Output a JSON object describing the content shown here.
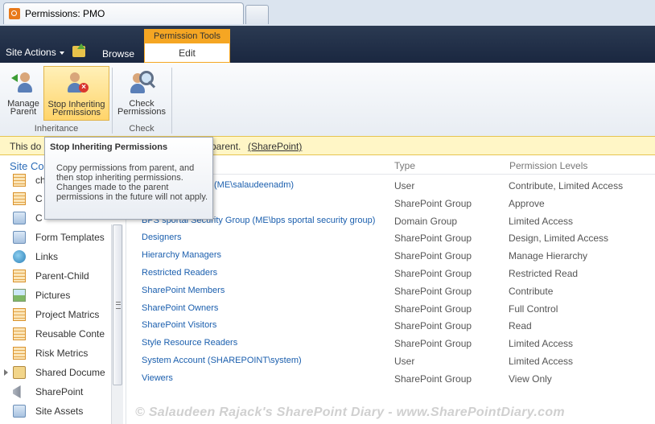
{
  "browser": {
    "tab_title": "Permissions: PMO"
  },
  "ribbon": {
    "site_actions": "Site Actions",
    "browse_tab": "Browse",
    "contextual_group": "Permission Tools",
    "edit_tab": "Edit",
    "buttons": {
      "manage_parent_l1": "Manage",
      "manage_parent_l2": "Parent",
      "stop_inheriting_l1": "Stop Inheriting",
      "stop_inheriting_l2": "Permissions",
      "check_permissions_l1": "Check",
      "check_permissions_l2": "Permissions"
    },
    "groups": {
      "inheritance": "Inheritance",
      "check": "Check"
    }
  },
  "notification": {
    "text_start": "This do",
    "text_end": "parent.",
    "link": "(SharePoint)"
  },
  "tooltip": {
    "title": "Stop Inheriting Permissions",
    "body": "Copy permissions from parent, and then stop inheriting permissions. Changes made to the parent permissions in the future will not apply."
  },
  "leftnav": {
    "header": "Site Co",
    "items": [
      {
        "label": "ch",
        "icon": "list-icon"
      },
      {
        "label": "C",
        "icon": "list-icon"
      },
      {
        "label": "C",
        "icon": "library-icon"
      },
      {
        "label": "Form Templates",
        "icon": "library-icon"
      },
      {
        "label": "Links",
        "icon": "links-icon"
      },
      {
        "label": "Parent-Child",
        "icon": "list-icon"
      },
      {
        "label": "Pictures",
        "icon": "picture-library-icon"
      },
      {
        "label": "Project Matrics",
        "icon": "list-icon"
      },
      {
        "label": "Reusable Conte",
        "icon": "list-icon"
      },
      {
        "label": "Risk Metrics",
        "icon": "list-icon"
      },
      {
        "label": "Shared Docume",
        "icon": "document-library-icon"
      },
      {
        "label": "SharePoint",
        "icon": "announcements-icon"
      },
      {
        "label": "Site Assets",
        "icon": "library-icon"
      }
    ]
  },
  "table": {
    "headers": {
      "type": "Type",
      "levels": "Permission Levels"
    },
    "rows": [
      {
        "name": "(ME\\salaudeenadm)",
        "type": "User",
        "levels": "Contribute, Limited Access"
      },
      {
        "name": "",
        "type": "SharePoint Group",
        "levels": "Approve"
      },
      {
        "name": "BPS sportal Security Group (ME\\bps sportal security group)",
        "type": "Domain Group",
        "levels": "Limited Access"
      },
      {
        "name": "Designers",
        "type": "SharePoint Group",
        "levels": "Design, Limited Access"
      },
      {
        "name": "Hierarchy Managers",
        "type": "SharePoint Group",
        "levels": "Manage Hierarchy"
      },
      {
        "name": "Restricted Readers",
        "type": "SharePoint Group",
        "levels": "Restricted Read"
      },
      {
        "name": "SharePoint Members",
        "type": "SharePoint Group",
        "levels": "Contribute"
      },
      {
        "name": "SharePoint Owners",
        "type": "SharePoint Group",
        "levels": "Full Control"
      },
      {
        "name": "SharePoint Visitors",
        "type": "SharePoint Group",
        "levels": "Read"
      },
      {
        "name": "Style Resource Readers",
        "type": "SharePoint Group",
        "levels": "Limited Access"
      },
      {
        "name": "System Account (SHAREPOINT\\system)",
        "type": "User",
        "levels": "Limited Access"
      },
      {
        "name": "Viewers",
        "type": "SharePoint Group",
        "levels": "View Only"
      }
    ]
  },
  "watermark": "© Salaudeen Rajack's SharePoint Diary - www.SharePointDiary.com"
}
